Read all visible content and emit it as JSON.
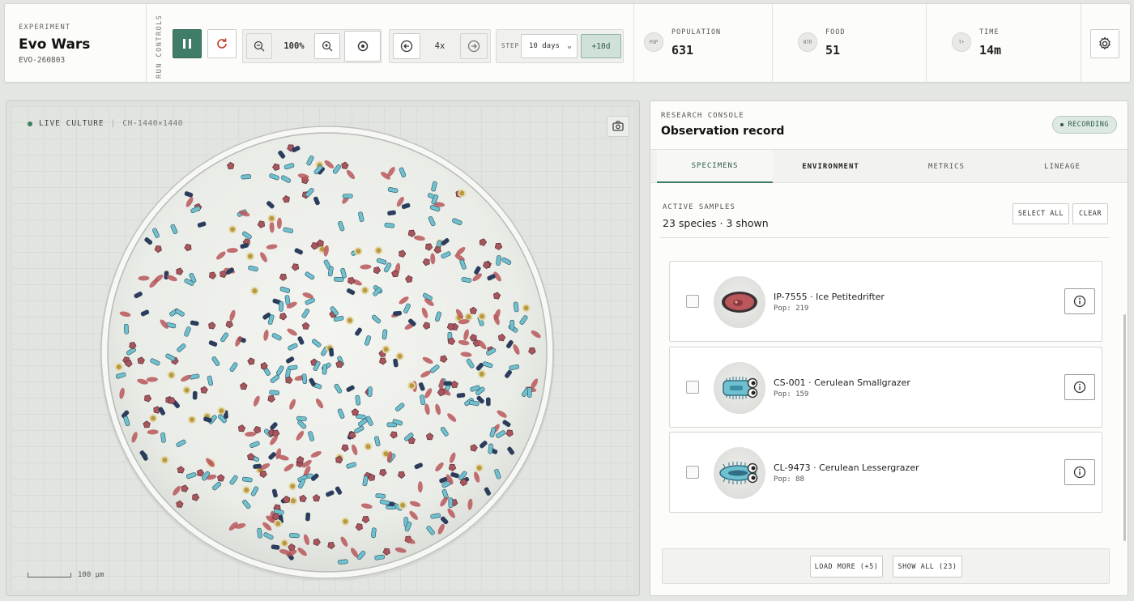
{
  "experiment": {
    "label": "EXPERIMENT",
    "title": "Evo Wars",
    "id": "EVO-260803"
  },
  "run_controls": {
    "label": "RUN CONTROLS",
    "zoom_value": "100%",
    "speed_value": "4x",
    "step_label": "STEP",
    "step_value": "10 days",
    "step_button": "+10d"
  },
  "stats": [
    {
      "badge": "POP",
      "label": "POPULATION",
      "value": "631"
    },
    {
      "badge": "NTR",
      "label": "FOOD",
      "value": "51"
    },
    {
      "badge": "T+",
      "label": "TIME",
      "value": "14m"
    }
  ],
  "culture": {
    "live_label": "LIVE CULTURE",
    "chamber": "CH-1440×1440",
    "scale_label": "100 µm"
  },
  "console": {
    "label": "RESEARCH CONSOLE",
    "title": "Observation record",
    "recording_label": "RECORDING",
    "tabs": [
      {
        "label": "SPECIMENS"
      },
      {
        "label": "ENVIRONMENT"
      },
      {
        "label": "METRICS"
      },
      {
        "label": "LINEAGE"
      }
    ],
    "samples_label": "ACTIVE SAMPLES",
    "samples_summary": "23 species · 3 shown",
    "select_all": "SELECT ALL",
    "clear": "CLEAR",
    "specimens": [
      {
        "name": "IP-7555 · Ice Petitedrifter",
        "pop": "Pop: 219",
        "color": "#b9575a"
      },
      {
        "name": "CS-001 · Cerulean Smallgrazer",
        "pop": "Pop: 159",
        "color": "#6fc1cf"
      },
      {
        "name": "CL-9473 · Cerulean Lessergrazer",
        "pop": "Pop: 88",
        "color": "#6fc1cf"
      }
    ],
    "load_more": "LOAD MORE (+5)",
    "show_all": "SHOW ALL (23)"
  },
  "colors": {
    "accent": "#3d7f62",
    "red_species": "#b9575a",
    "blue_species": "#6fc1cf",
    "navy_species": "#2e3a5e",
    "rose_species": "#a8565e",
    "food": "#b89a3e"
  }
}
